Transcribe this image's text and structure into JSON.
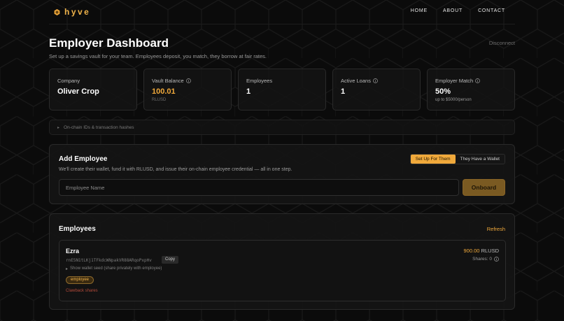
{
  "nav": {
    "brand": "hyve",
    "links": [
      "HOME",
      "ABOUT",
      "CONTACT"
    ]
  },
  "header": {
    "title": "Employer Dashboard",
    "subtitle": "Set up a savings vault for your team. Employees deposit, you match, they borrow at fair rates.",
    "disconnect": "Disconnect"
  },
  "stats": [
    {
      "label": "Company",
      "value": "Oliver Crop",
      "sub": ""
    },
    {
      "label": "Vault Balance",
      "value": "100.01",
      "sub": "RLUSD"
    },
    {
      "label": "Employees",
      "value": "1",
      "sub": ""
    },
    {
      "label": "Active Loans",
      "value": "1",
      "sub": ""
    },
    {
      "label": "Employer Match",
      "value": "50%",
      "sub": "up to $5000/person"
    }
  ],
  "onchain": {
    "label": "On-chain IDs & transaction hashes"
  },
  "add_employee": {
    "title": "Add Employee",
    "description": "We'll create their wallet, fund it with RLUSD, and issue their on-chain employee credential — all in one step.",
    "toggle_active": "Set Up For Them",
    "toggle_other": "They Have a Wallet",
    "input_placeholder": "Employee Name",
    "input_value": "",
    "submit_label": "Onboard"
  },
  "employees": {
    "title": "Employees",
    "refresh_label": "Refresh",
    "items": [
      {
        "name": "Ezra",
        "address": "rnE5N1tLKj1TFkdcWNpakVR88ARqoPxpHv",
        "copy_label": "Copy",
        "seed_toggle": "Show wallet seed (share privately with employee)",
        "badge": "employee",
        "clawback": "Clawback shares",
        "balance_amount": "900.00",
        "balance_unit": "RLUSD",
        "shares_label": "Shares: 0"
      }
    ]
  },
  "colors": {
    "accent": "#f0a93b",
    "background": "#0b0b0b",
    "card": "#141414",
    "danger": "#b44a3a"
  },
  "icons": {
    "brand": "hexagon-logo-icon",
    "info": "info-circle-icon",
    "chevron": "chevron-right-icon",
    "disclosure": "triangle-right-icon"
  }
}
